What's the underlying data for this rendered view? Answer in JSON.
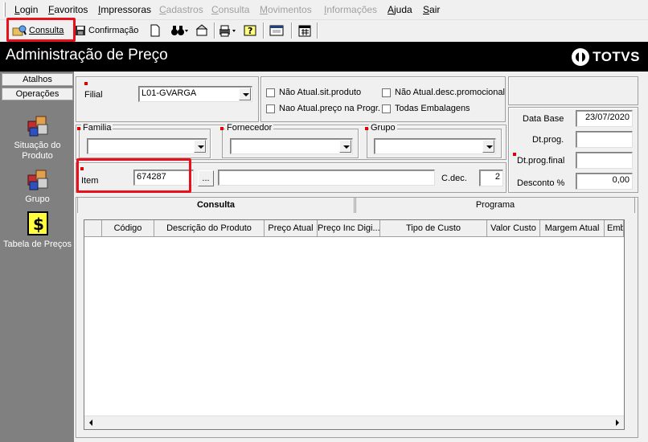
{
  "menu": {
    "items": [
      {
        "label": "Login",
        "disabled": false
      },
      {
        "label": "Favoritos",
        "disabled": false
      },
      {
        "label": "Impressoras",
        "disabled": false
      },
      {
        "label": "Cadastros",
        "disabled": true
      },
      {
        "label": "Consulta",
        "disabled": true
      },
      {
        "label": "Movimentos",
        "disabled": true
      },
      {
        "label": "Informações",
        "disabled": true
      },
      {
        "label": "Ajuda",
        "disabled": false
      },
      {
        "label": "Sair",
        "disabled": false
      }
    ]
  },
  "toolbar": {
    "consulta_label": "Consulta",
    "confirmacao_label": "Confirmação"
  },
  "header": {
    "title": "Administração de Preço",
    "brand": "TOTVS"
  },
  "sidebar": {
    "tab_atalhos": "Atalhos",
    "tab_operacoes": "Operações",
    "items": [
      {
        "label": "Situação do Produto"
      },
      {
        "label": "Grupo"
      },
      {
        "label": "Tabela de Preços"
      }
    ]
  },
  "form": {
    "filial_label": "Filial",
    "filial_value": "L01-GVARGA",
    "chk_nao_atual_sit": "Não Atual.sit.produto",
    "chk_nao_atual_desc": "Não Atual.desc.promocional",
    "chk_nao_atual_preco": "Nao Atual.preço na Progr.",
    "chk_todas_embalagens": "Todas Embalagens",
    "familia_label": "Familia",
    "fornecedor_label": "Fornecedor",
    "grupo_label": "Grupo",
    "item_label": "Item",
    "item_value": "674287",
    "ellipsis_label": "...",
    "cdec_label": "C.dec.",
    "cdec_value": "2",
    "data_base_label": "Data Base",
    "data_base_value": "23/07/2020",
    "dt_prog_label": "Dt.prog.",
    "dt_prog_final_label": "Dt.prog.final",
    "desconto_label": "Desconto %",
    "desconto_value": "0,00"
  },
  "tabs": [
    {
      "label": "Consulta",
      "active": true
    },
    {
      "label": "Programa",
      "active": false
    }
  ],
  "grid": {
    "columns": [
      "Código",
      "Descrição do Produto",
      "Preço Atual",
      "Preço Inc Digi...",
      "Tipo de Custo",
      "Valor Custo",
      "Margem Atual",
      "Emb"
    ]
  },
  "colors": {
    "highlight": "#e8101a",
    "header_bg": "#000000",
    "sidebar_bg": "#808080"
  }
}
